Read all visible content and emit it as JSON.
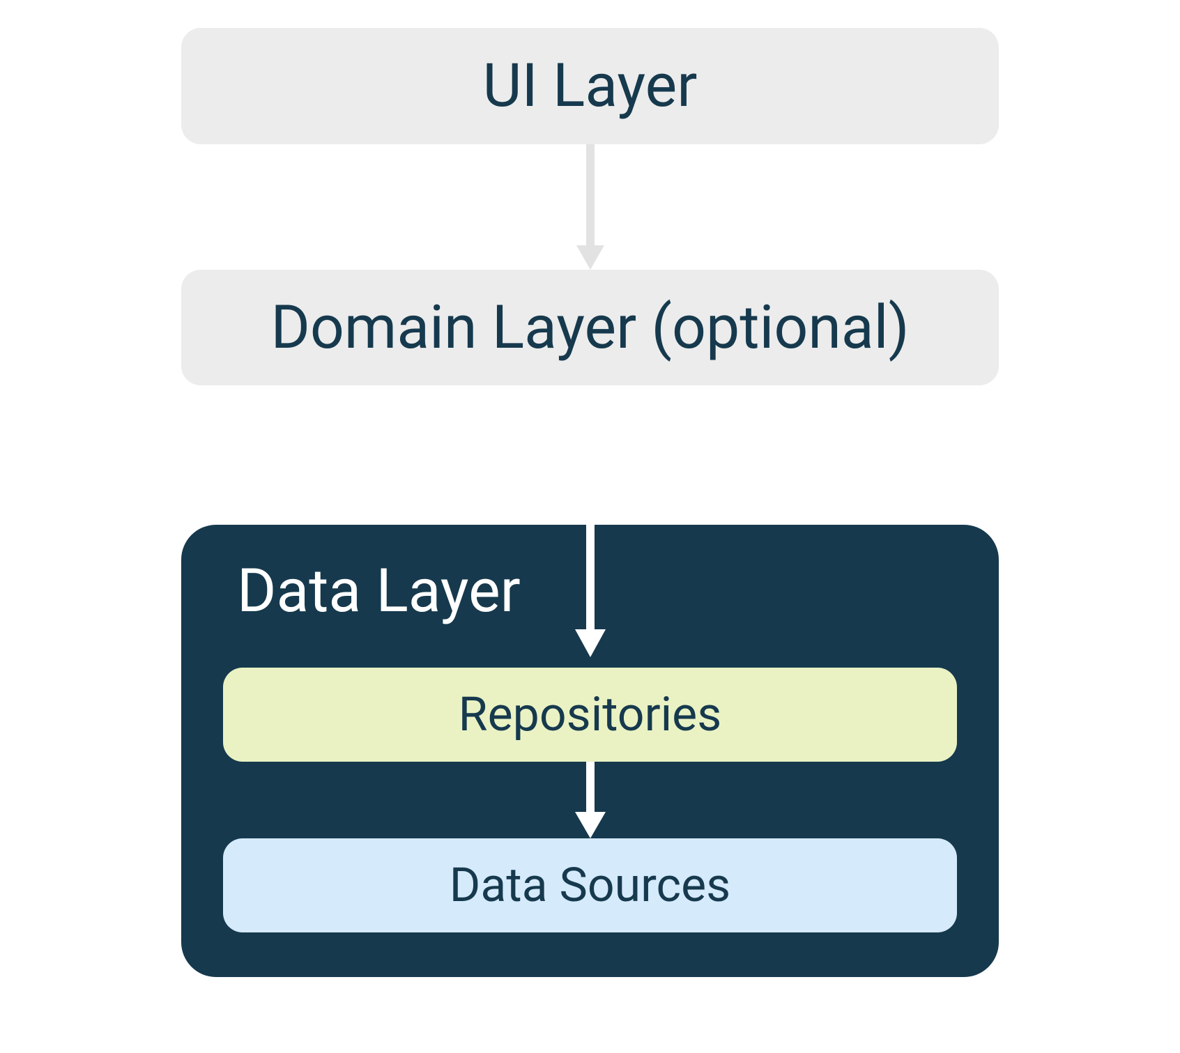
{
  "layers": {
    "ui": "UI Layer",
    "domain": "Domain Layer (optional)",
    "data_title": "Data Layer",
    "repositories": "Repositories",
    "data_sources": "Data Sources"
  },
  "colors": {
    "light_box_bg": "#ECECEC",
    "dark_text": "#16394D",
    "data_container_bg": "#16394D",
    "repo_bg": "#EAF2C4",
    "data_sources_bg": "#D5EAFB",
    "arrow_light": "#E2E2E2",
    "arrow_white": "#FFFFFF"
  }
}
